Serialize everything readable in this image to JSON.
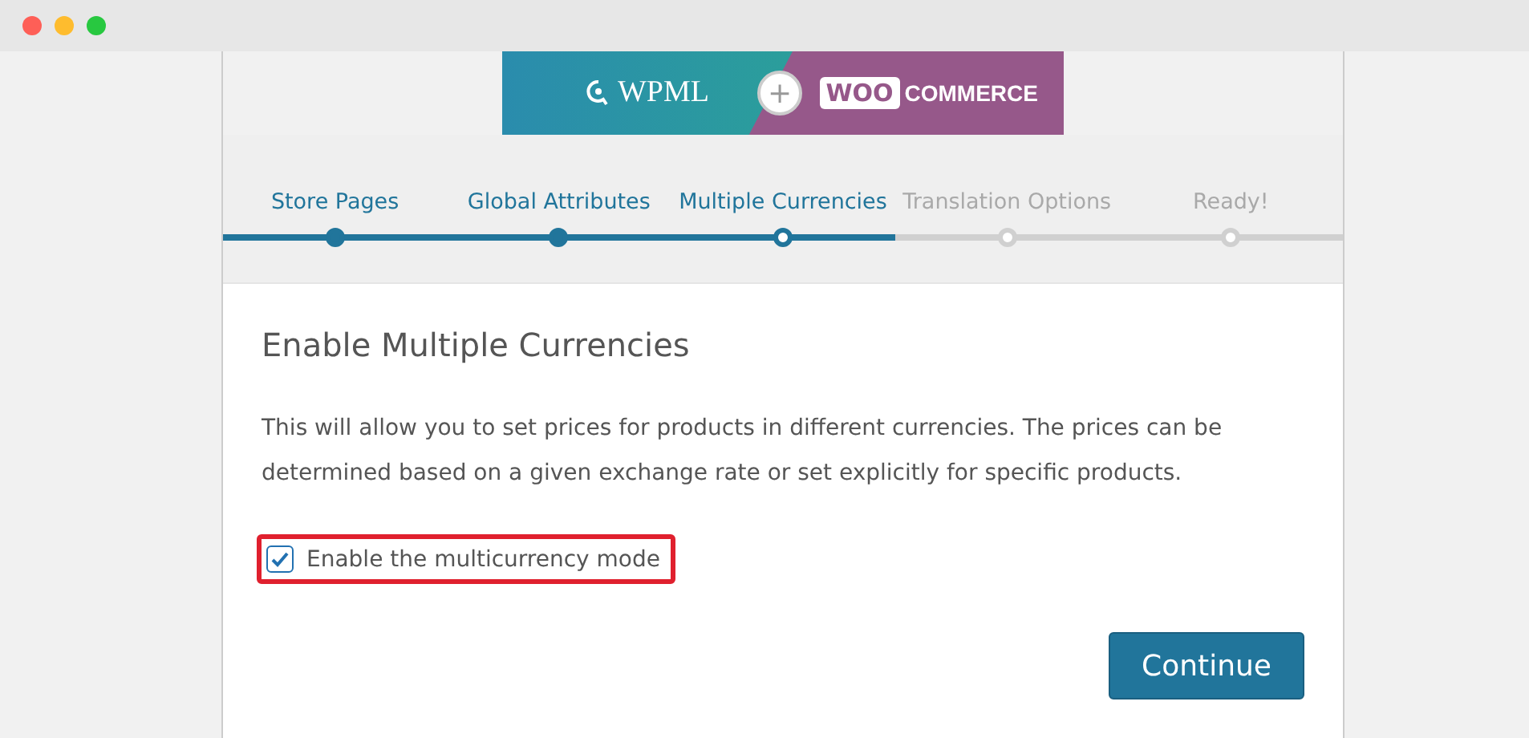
{
  "banner": {
    "left_logo": "WPML",
    "joiner": "+",
    "right_logo_mark": "WOO",
    "right_logo_text": "COMMERCE"
  },
  "steps": [
    {
      "label": "Store Pages",
      "completed": true,
      "selected": false
    },
    {
      "label": "Global Attributes",
      "completed": true,
      "selected": false
    },
    {
      "label": "Multiple Currencies",
      "completed": false,
      "selected": true
    },
    {
      "label": "Translation Options",
      "completed": false,
      "selected": false
    },
    {
      "label": "Ready!",
      "completed": false,
      "selected": false
    }
  ],
  "heading": "Enable Multiple Currencies",
  "description": "This will allow you to set prices for products in different currencies. The prices can be determined based on a given exchange rate or set explicitly for specific products.",
  "option": {
    "label": "Enable the multicurrency mode",
    "checked": true,
    "highlighted": true
  },
  "buttons": [
    {
      "label": "Continue"
    }
  ]
}
